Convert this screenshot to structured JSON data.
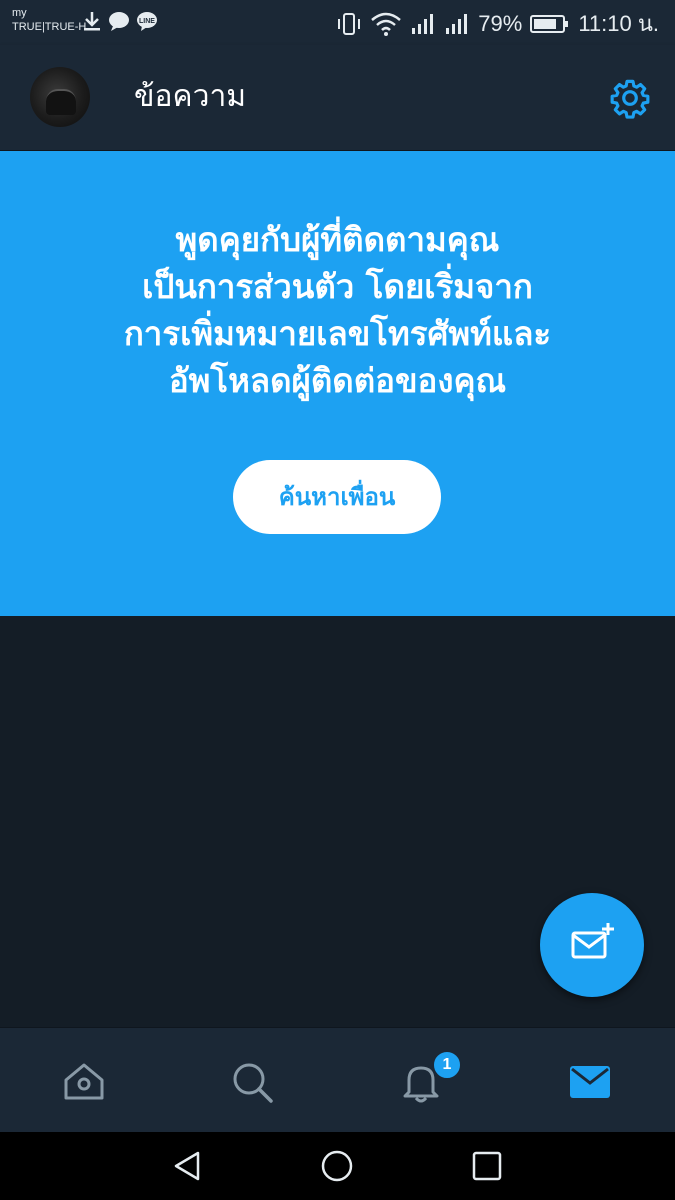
{
  "status_bar": {
    "carrier_top": "my",
    "carrier_bottom": "TRUE|TRUE-H",
    "battery_percent": "79%",
    "time": "11:10 น."
  },
  "header": {
    "title": "ข้อความ",
    "settings_icon": "gear-icon"
  },
  "hero": {
    "lines": [
      "พูดคุยกับผู้ที่ติดตามคุณ",
      "เป็นการส่วนตัว โดยเริ่มจาก",
      "การเพิ่มหมายเลขโทรศัพท์และ",
      "อัพโหลดผู้ติดต่อของคุณ"
    ],
    "button_label": "ค้นหาเพื่อน"
  },
  "fab": {
    "icon": "new-message-icon"
  },
  "bottom_nav": {
    "items": [
      {
        "name": "home",
        "icon": "home-icon"
      },
      {
        "name": "search",
        "icon": "search-icon"
      },
      {
        "name": "notifications",
        "icon": "bell-icon",
        "badge": "1"
      },
      {
        "name": "messages",
        "icon": "mail-icon",
        "active": true
      }
    ]
  },
  "colors": {
    "accent": "#1da1f2",
    "background": "#141d26",
    "bar": "#1b2836",
    "icon_inactive": "#8899a6"
  }
}
